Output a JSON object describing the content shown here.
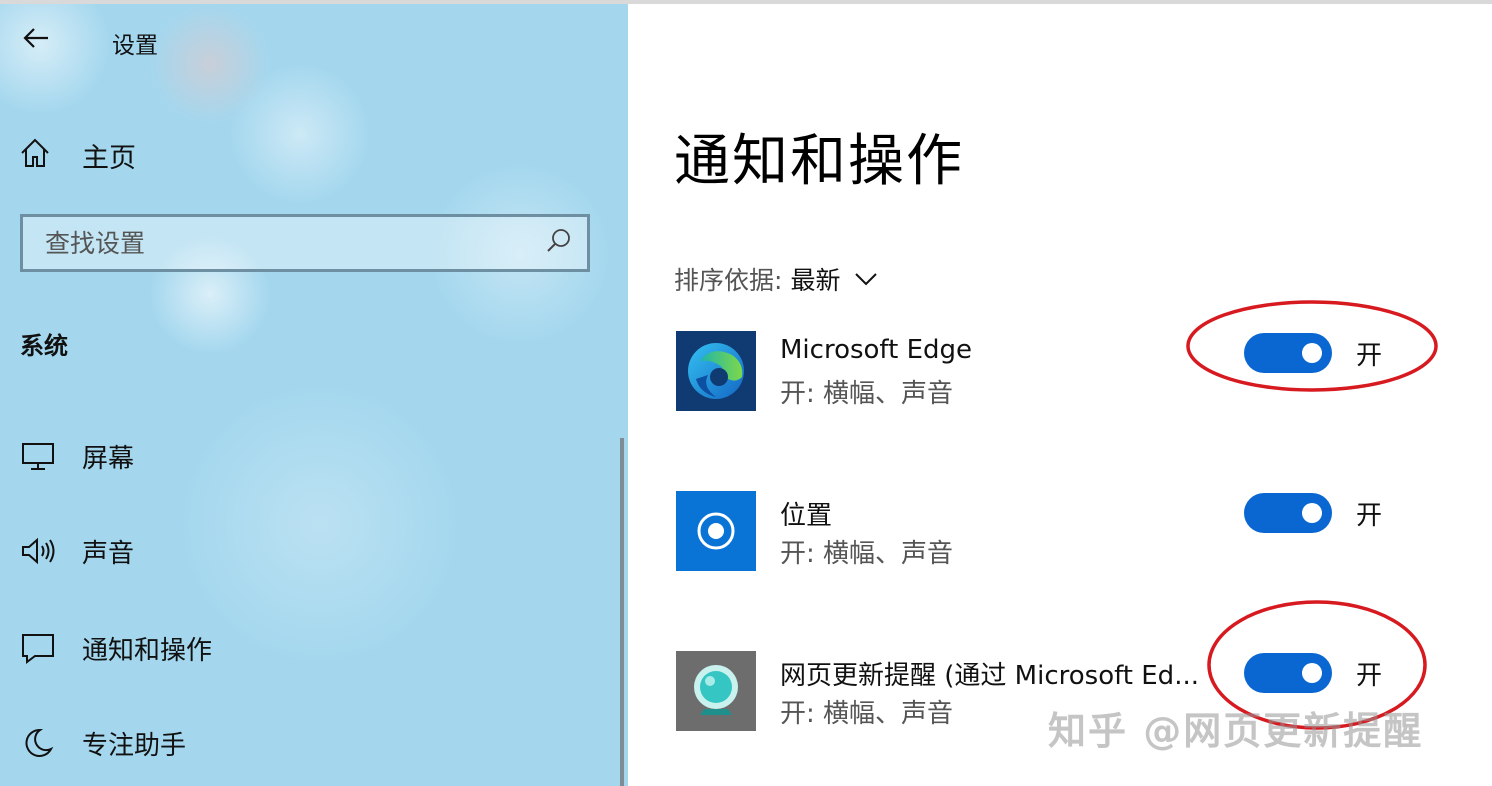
{
  "window": {
    "title": "设置"
  },
  "sidebar": {
    "home_label": "主页",
    "search_placeholder": "查找设置",
    "section_title": "系统",
    "items": [
      {
        "label": "屏幕",
        "icon": "monitor-icon"
      },
      {
        "label": "声音",
        "icon": "speaker-icon"
      },
      {
        "label": "通知和操作",
        "icon": "notification-icon"
      },
      {
        "label": "专注助手",
        "icon": "moon-icon"
      }
    ]
  },
  "main": {
    "title": "通知和操作",
    "sort_label": "排序依据:",
    "sort_value": "最新",
    "apps": [
      {
        "name": "Microsoft Edge",
        "status": "开: 横幅、声音",
        "toggle_state": "开",
        "icon": "edge-logo-icon",
        "icon_bg": "#103b72",
        "highlighted": true
      },
      {
        "name": "位置",
        "status": "开: 横幅、声音",
        "toggle_state": "开",
        "icon": "location-icon",
        "icon_bg": "#0a74d6",
        "highlighted": false
      },
      {
        "name": "网页更新提醒 (通过 Microsoft Ed...",
        "status": "开: 横幅、声音",
        "toggle_state": "开",
        "icon": "webcam-bot-icon",
        "icon_bg": "#6d6d6d",
        "highlighted": true
      }
    ]
  },
  "watermark": "知乎 @网页更新提醒",
  "colors": {
    "sidebar_bg": "#a4d7ee",
    "toggle_on": "#0a67d2",
    "annotation": "#d71920"
  }
}
